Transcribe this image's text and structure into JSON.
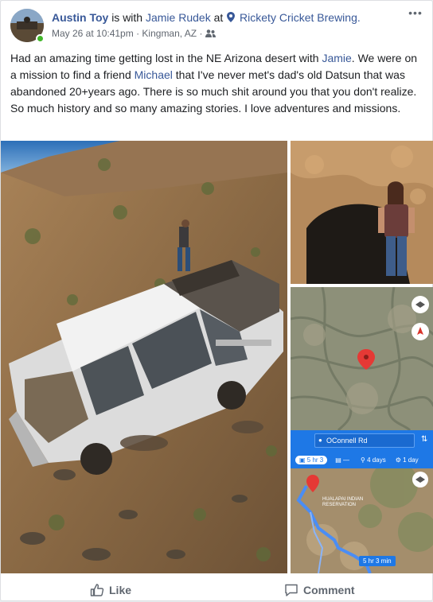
{
  "post": {
    "author": "Austin Toy",
    "with_text": "is with",
    "tagged": "Jamie Rudek",
    "at_text": "at",
    "place": "Rickety Cricket Brewing.",
    "date": "May 26 at 10:41pm",
    "sep1": "·",
    "location": "Kingman, AZ",
    "sep2": "·",
    "audience_icon": "friends-icon",
    "more_icon": "more-options-icon"
  },
  "text": {
    "part1": "Had an amazing time getting lost in the NE Arizona desert with ",
    "mention1": "Jamie",
    "part2": ". We were on a mission to find a friend ",
    "mention2": "Michael",
    "part3": " that I've never met's dad's old Datsun that was abandoned 20+years ago. There is so much shit around you that you don't realize. So much history and so many amazing stories. I love adventures and missions."
  },
  "map2": {
    "search": "OConnell Rd",
    "modes": [
      {
        "label": "5 hr 3",
        "icon": "car-icon"
      },
      {
        "label": "—",
        "icon": "transit-icon"
      },
      {
        "label": "4 days",
        "icon": "walk-icon"
      },
      {
        "label": "1 day",
        "icon": "bike-icon"
      }
    ],
    "place_label1": "HUALAPAI INDIAN",
    "place_label2": "RESERVATION",
    "route_time": "5 hr 3 min"
  },
  "actions": {
    "like": "Like",
    "comment": "Comment"
  }
}
